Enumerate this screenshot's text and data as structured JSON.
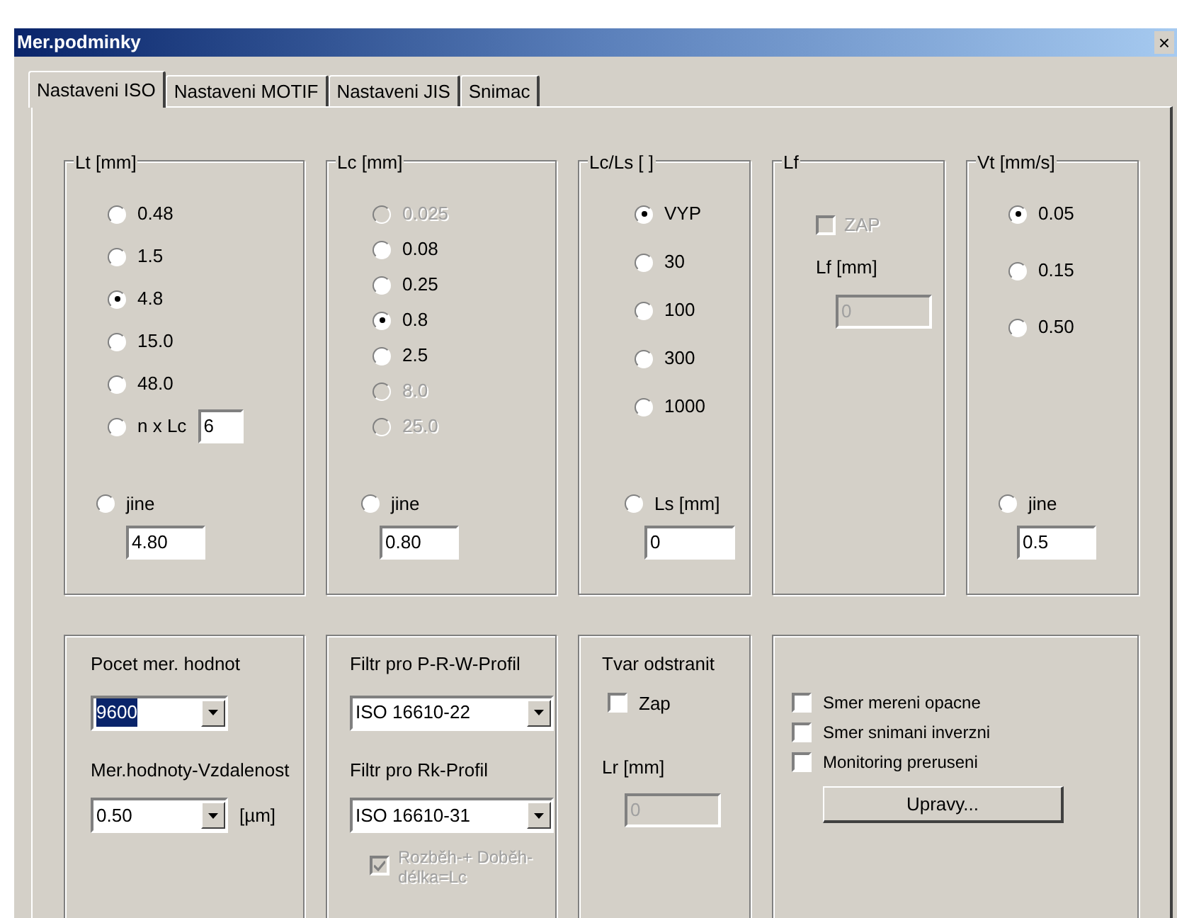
{
  "window": {
    "title": "Mer.podminky",
    "close": "×"
  },
  "tabs": [
    {
      "label": "Nastaveni ISO",
      "selected": true
    },
    {
      "label": "Nastaveni MOTIF",
      "selected": false
    },
    {
      "label": "Nastaveni JIS",
      "selected": false
    },
    {
      "label": "Snimac",
      "selected": false
    }
  ],
  "groups": [
    {
      "kind": "radios",
      "legend": "Lt [mm]",
      "options": [
        {
          "label": "0.48",
          "selected": false,
          "disabled": false
        },
        {
          "label": "1.5",
          "selected": false,
          "disabled": false
        },
        {
          "label": "4.8",
          "selected": true,
          "disabled": false
        },
        {
          "label": "15.0",
          "selected": false,
          "disabled": false
        },
        {
          "label": "48.0",
          "selected": false,
          "disabled": false
        },
        {
          "label": "n x Lc",
          "selected": false,
          "disabled": false,
          "field": "6"
        }
      ],
      "custom": {
        "label": "jine",
        "selected": false,
        "value": "4.80"
      }
    },
    {
      "kind": "radios",
      "legend": "Lc [mm]",
      "options": [
        {
          "label": "0.025",
          "selected": false,
          "disabled": true
        },
        {
          "label": "0.08",
          "selected": false,
          "disabled": false
        },
        {
          "label": "0.25",
          "selected": false,
          "disabled": false
        },
        {
          "label": "0.8",
          "selected": true,
          "disabled": false
        },
        {
          "label": "2.5",
          "selected": false,
          "disabled": false
        },
        {
          "label": "8.0",
          "selected": false,
          "disabled": true
        },
        {
          "label": "25.0",
          "selected": false,
          "disabled": true
        }
      ],
      "custom": {
        "label": "jine",
        "selected": false,
        "value": "0.80"
      }
    },
    {
      "kind": "radios",
      "legend": "Lc/Ls [ ]",
      "options": [
        {
          "label": "VYP",
          "selected": true,
          "disabled": false
        },
        {
          "label": "30",
          "selected": false,
          "disabled": false
        },
        {
          "label": "100",
          "selected": false,
          "disabled": false
        },
        {
          "label": "300",
          "selected": false,
          "disabled": false
        },
        {
          "label": "1000",
          "selected": false,
          "disabled": false
        }
      ],
      "custom": {
        "label": "Ls [mm]",
        "selected": false,
        "value": "0"
      }
    },
    {
      "kind": "switch",
      "legend": "Lf",
      "checkbox": {
        "label": "ZAP",
        "checked": false,
        "disabled": true
      },
      "field_label": "Lf [mm]",
      "field": {
        "value": "0",
        "disabled": true
      }
    },
    {
      "kind": "radios",
      "legend": "Vt [mm/s]",
      "options": [
        {
          "label": "0.05",
          "selected": true,
          "disabled": false
        },
        {
          "label": "0.15",
          "selected": false,
          "disabled": false
        },
        {
          "label": "0.50",
          "selected": false,
          "disabled": false
        }
      ],
      "custom": {
        "label": "jine",
        "selected": false,
        "value": "0.5"
      }
    }
  ],
  "sampling": {
    "count_label": "Pocet mer. hodnot",
    "count": {
      "value": "9600",
      "highlighted": true
    },
    "spacing_label": "Mer.hodnoty-Vzdalenost",
    "spacing": {
      "value": "0.50",
      "highlighted": false
    },
    "unit": "[µm]"
  },
  "filters": {
    "prw_label": "Filtr pro P-R-W-Profil",
    "prw": "ISO 16610-22",
    "rk_label": "Filtr pro Rk-Profil",
    "rk": "ISO 16610-31",
    "checkbox": {
      "label": "Rozběh-+ Doběh-délka=Lc",
      "checked": true,
      "disabled": true
    }
  },
  "form_removal": {
    "title": "Tvar odstranit",
    "checkbox": {
      "label": "Zap",
      "checked": false,
      "disabled": false
    },
    "field_label": "Lr [mm]",
    "field": {
      "value": "0",
      "disabled": true
    }
  },
  "options": {
    "checkboxes": [
      {
        "label": "Smer mereni opacne",
        "checked": false,
        "disabled": false
      },
      {
        "label": "Smer snimani inverzni",
        "checked": false,
        "disabled": false
      },
      {
        "label": "Monitoring preruseni",
        "checked": false,
        "disabled": false
      }
    ],
    "button": "Upravy..."
  }
}
